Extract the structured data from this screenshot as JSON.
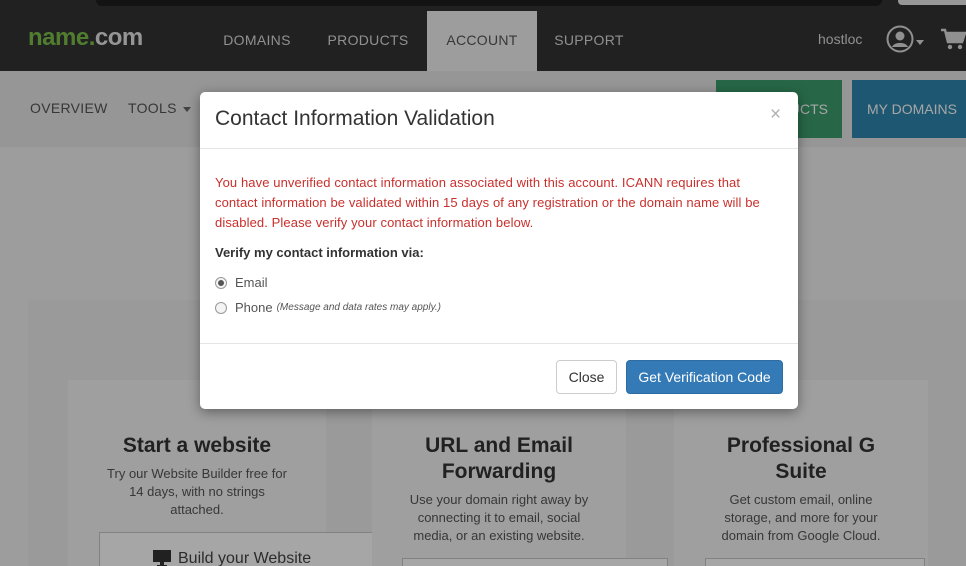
{
  "header": {
    "logo_part1": "name",
    "logo_dot": ".",
    "logo_part2": "com",
    "nav": [
      {
        "label": "DOMAINS"
      },
      {
        "label": "PRODUCTS"
      },
      {
        "label": "ACCOUNT"
      },
      {
        "label": "SUPPORT"
      }
    ],
    "active_nav": "ACCOUNT",
    "username": "hostloc",
    "icons": {
      "avatar": "user-circle-icon",
      "cart": "cart-icon"
    }
  },
  "subnav": {
    "items": [
      {
        "label": "OVERVIEW"
      },
      {
        "label": "TOOLS"
      }
    ],
    "products_button": "UCTS",
    "my_domains_button": "MY DOMAINS"
  },
  "cards": [
    {
      "title": "Start a website",
      "desc": [
        "Try our Website Builder free for",
        "14 days, with no strings",
        "attached."
      ],
      "cta": "Build your Website"
    },
    {
      "title_lines": [
        "URL and Email",
        "Forwarding"
      ],
      "desc": [
        "Use your domain right away by",
        "connecting it to email, social",
        "media, or an existing website."
      ]
    },
    {
      "title_lines": [
        "Professional G",
        "Suite"
      ],
      "desc": [
        "Get custom email, online",
        "storage, and more for your",
        "domain from Google Cloud."
      ]
    }
  ],
  "modal": {
    "title": "Contact Information Validation",
    "close_glyph": "×",
    "warning": "You have unverified contact information associated with this account. ICANN requires that contact information be validated within 15 days of any registration or the domain name will be disabled. Please verify your contact information below.",
    "verify_label": "Verify my contact information via:",
    "options": [
      {
        "label": "Email",
        "checked": true
      },
      {
        "label": "Phone",
        "note": "(Message and data rates may apply.)",
        "checked": false
      }
    ],
    "close_button": "Close",
    "verify_button": "Get Verification Code"
  },
  "colors": {
    "nav_bg": "#333333",
    "logo_green": "#7dc04b",
    "products_green": "#3c9f6e",
    "mydomains_blue": "#2d86b0",
    "warning_red": "#c9302c",
    "primary_blue": "#337ab7"
  }
}
